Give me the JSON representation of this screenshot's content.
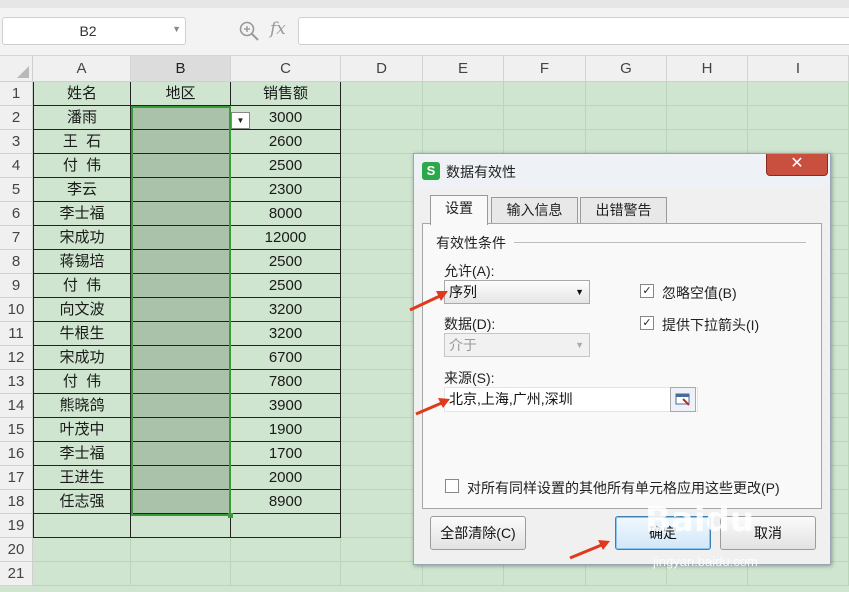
{
  "formula_bar": {
    "name_box": "B2",
    "fx_label": "fx",
    "formula_value": ""
  },
  "sheet": {
    "columns": [
      "A",
      "B",
      "C",
      "D",
      "E",
      "F",
      "G",
      "H",
      "I"
    ],
    "selected_column": "B",
    "rows": [
      "1",
      "2",
      "3",
      "4",
      "5",
      "6",
      "7",
      "8",
      "9",
      "10",
      "11",
      "12",
      "13",
      "14",
      "15",
      "16",
      "17",
      "18",
      "19",
      "20",
      "21"
    ],
    "header": [
      "姓名",
      "地区",
      "销售额"
    ],
    "data": [
      [
        "潘雨",
        "",
        "3000"
      ],
      [
        "王  石",
        "",
        "2600"
      ],
      [
        "付  伟",
        "",
        "2500"
      ],
      [
        "李云",
        "",
        "2300"
      ],
      [
        "李士福",
        "",
        "8000"
      ],
      [
        "宋成功",
        "",
        "12000"
      ],
      [
        "蒋锡培",
        "",
        "2500"
      ],
      [
        "付  伟",
        "",
        "2500"
      ],
      [
        "向文波",
        "",
        "3200"
      ],
      [
        "牛根生",
        "",
        "3200"
      ],
      [
        "宋成功",
        "",
        "6700"
      ],
      [
        "付  伟",
        "",
        "7800"
      ],
      [
        "熊晓鸽",
        "",
        "3900"
      ],
      [
        "叶茂中",
        "",
        "1900"
      ],
      [
        "李士福",
        "",
        "1700"
      ],
      [
        "王进生",
        "",
        "2000"
      ],
      [
        "任志强",
        "",
        "8900"
      ]
    ]
  },
  "dialog": {
    "logo": "S",
    "title": "数据有效性",
    "close_label": "✕",
    "tabs": [
      "设置",
      "输入信息",
      "出错警告"
    ],
    "active_tab": "设置",
    "group_title": "有效性条件",
    "allow_label": "允许(A):",
    "allow_value": "序列",
    "data_label": "数据(D):",
    "data_value": "介于",
    "ignore_blank_label": "忽略空值(B)",
    "ignore_blank_checked": true,
    "dropdown_label": "提供下拉箭头(I)",
    "dropdown_checked": true,
    "source_label": "来源(S):",
    "source_value": "北京,上海,广州,深圳",
    "apply_all_label": "对所有同样设置的其他所有单元格应用这些更改(P)",
    "apply_all_checked": false,
    "clear_all_label": "全部清除(C)",
    "ok_label": "确定",
    "cancel_label": "取消"
  },
  "watermark": {
    "logo": "Baidu",
    "text": "jingyan.baidu.com"
  },
  "colors": {
    "sheet_bg": "#cfe5cf",
    "selected_fill": "#a9c2a9",
    "selection_border": "#3a9a3a",
    "annotation_arrow": "#e03a1e",
    "dialog_close": "#c9503f"
  }
}
